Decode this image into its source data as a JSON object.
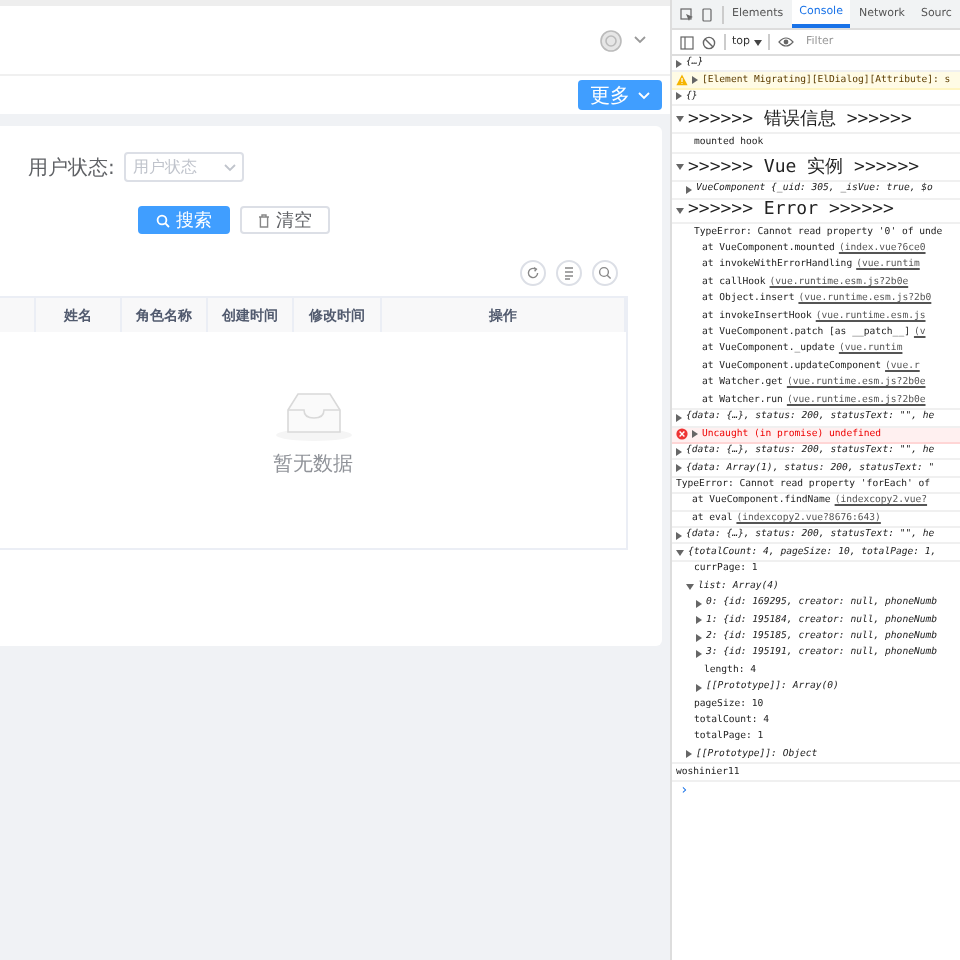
{
  "header": {
    "more_button": "更多"
  },
  "filter": {
    "label": "用户状态:",
    "select": {
      "placeholder": "用户状态"
    }
  },
  "buttons": [
    {
      "label": "搜索",
      "kind": "primary"
    },
    {
      "label": "清空",
      "kind": "default"
    }
  ],
  "table": {
    "columns": [
      "姓名",
      "角色名称",
      "创建时间",
      "修改时间",
      "操作"
    ],
    "empty_text": "暂无数据"
  },
  "devtools": {
    "tabs": [
      {
        "label": "Elements",
        "selected": false
      },
      {
        "label": "Console",
        "selected": true
      },
      {
        "label": "Network",
        "selected": false
      },
      {
        "label": "Sourc",
        "selected": false
      }
    ],
    "context": "top",
    "filter": {
      "placeholder": "Filter"
    },
    "console": {
      "messages": [
        {
          "kind": "object",
          "text": "{…}",
          "expanded": false
        },
        {
          "kind": "warning",
          "text": "[Element Migrating][ElDialog][Attribute]: s",
          "expanded": false
        },
        {
          "kind": "object",
          "text": "{}",
          "expanded": false
        },
        {
          "kind": "group",
          "text": ">>>>>> 错误信息 >>>>>>",
          "expanded": true,
          "children": [
            {
              "kind": "text",
              "text": "mounted hook"
            }
          ]
        },
        {
          "kind": "group",
          "text": ">>>>>> Vue 实例 >>>>>>",
          "expanded": true,
          "children": [
            {
              "kind": "object",
              "text": "VueComponent {_uid: 305, _isVue: true, $o",
              "expanded": false
            }
          ]
        },
        {
          "kind": "group",
          "text": ">>>>>> Error >>>>>>",
          "expanded": true,
          "children": [
            {
              "kind": "text",
              "text": "TypeError: Cannot read property '0' of unde"
            },
            {
              "kind": "stack",
              "text": "at VueComponent.mounted",
              "link": "(index.vue?6ce0"
            },
            {
              "kind": "stack",
              "text": "at invokeWithErrorHandling",
              "link": "(vue.runtim"
            },
            {
              "kind": "stack",
              "text": "at callHook",
              "link": "(vue.runtime.esm.js?2b0e"
            },
            {
              "kind": "stack",
              "text": "at Object.insert",
              "link": "(vue.runtime.esm.js?2b0"
            },
            {
              "kind": "stack",
              "text": "at invokeInsertHook",
              "link": "(vue.runtime.esm.js"
            },
            {
              "kind": "stack",
              "text": "at VueComponent.patch [as __patch__]",
              "link": "(v"
            },
            {
              "kind": "stack",
              "text": "at VueComponent._update",
              "link": "(vue.runtim"
            },
            {
              "kind": "stack",
              "text": "at VueComponent.updateComponent",
              "link": "(vue.r"
            },
            {
              "kind": "stack",
              "text": "at Watcher.get",
              "link": "(vue.runtime.esm.js?2b0e"
            },
            {
              "kind": "stack",
              "text": "at Watcher.run",
              "link": "(vue.runtime.esm.js?2b0e"
            }
          ]
        },
        {
          "kind": "object",
          "text": "{data: {…}, status: 200, statusText: \"\", he",
          "expanded": false
        },
        {
          "kind": "error",
          "text": "Uncaught (in promise) undefined",
          "expanded": false
        },
        {
          "kind": "object",
          "text": "{data: {…}, status: 200, statusText: \"\", he",
          "expanded": false
        },
        {
          "kind": "object",
          "text": "{data: Array(1), status: 200, statusText: \"",
          "expanded": false
        },
        {
          "kind": "text",
          "text": "TypeError: Cannot read property 'forEach' of"
        },
        {
          "kind": "stack",
          "text": "at VueComponent.findName",
          "link": "(indexcopy2.vue?"
        },
        {
          "kind": "stack",
          "text": "at eval",
          "link": "(indexcopy2.vue?8676:643)"
        },
        {
          "kind": "object",
          "text": "{data: {…}, status: 200, statusText: \"\", he",
          "expanded": false
        },
        {
          "kind": "object",
          "text": "{totalCount: 4, pageSize: 10, totalPage: 1,",
          "expanded": true,
          "children": [
            {
              "kind": "text",
              "text": "currPage: 1"
            },
            {
              "kind": "object",
              "text": "list: Array(4)",
              "expanded": true,
              "children": [
                {
                  "kind": "object",
                  "text": "0: {id: 169295, creator: null, phoneNumb",
                  "expanded": false
                },
                {
                  "kind": "object",
                  "text": "1: {id: 195184, creator: null, phoneNumb",
                  "expanded": false
                },
                {
                  "kind": "object",
                  "text": "2: {id: 195185, creator: null, phoneNumb",
                  "expanded": false
                },
                {
                  "kind": "object",
                  "text": "3: {id: 195191, creator: null, phoneNumb",
                  "expanded": false
                },
                {
                  "kind": "text",
                  "text": "length: 4"
                },
                {
                  "kind": "object",
                  "text": "[[Prototype]]: Array(0)",
                  "expanded": false
                }
              ]
            },
            {
              "kind": "text",
              "text": "pageSize: 10"
            },
            {
              "kind": "text",
              "text": "totalCount: 4"
            },
            {
              "kind": "text",
              "text": "totalPage: 1"
            },
            {
              "kind": "object",
              "text": "[[Prototype]]: Object",
              "expanded": false
            }
          ]
        },
        {
          "kind": "text",
          "text": "woshinier11"
        }
      ],
      "prompt": "›"
    }
  }
}
